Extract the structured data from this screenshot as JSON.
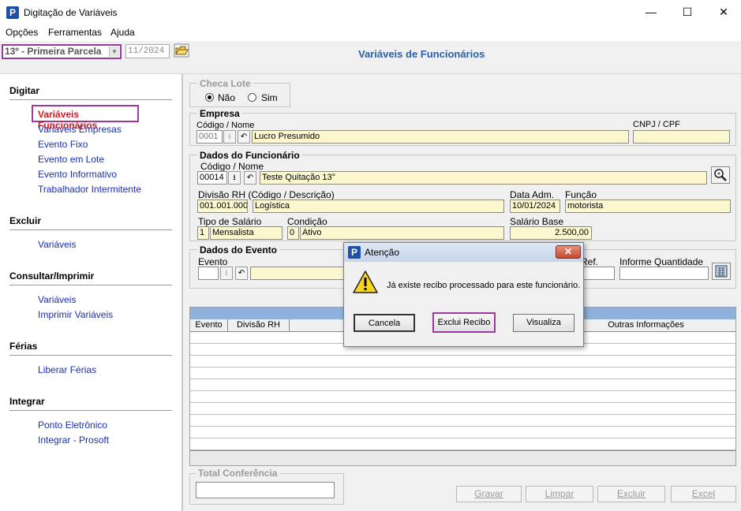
{
  "window": {
    "title": "Digitação de Variáveis",
    "app_icon": "P",
    "controls": {
      "minimize": "—",
      "maximize": "☐",
      "close": "✕"
    }
  },
  "menu": [
    "Opções",
    "Ferramentas",
    "Ajuda"
  ],
  "toolbar": {
    "parcela": "13º - Primeira Parcela",
    "competencia": "11/2024",
    "page_title": "Variáveis de Funcionários"
  },
  "sidebar": {
    "digitar": {
      "header": "Digitar",
      "items": [
        "Variáveis Funcionários",
        "Variáveis Empresas",
        "Evento Fixo",
        "Evento em Lote",
        "Evento Informativo",
        "Trabalhador Intermitente"
      ]
    },
    "excluir": {
      "header": "Excluir",
      "items": [
        "Variáveis"
      ]
    },
    "consultar": {
      "header": "Consultar/Imprimir",
      "items": [
        "Variáveis",
        "Imprimir Variáveis"
      ]
    },
    "ferias": {
      "header": "Férias",
      "items": [
        "Liberar Férias"
      ]
    },
    "integrar": {
      "header": "Integrar",
      "items": [
        "Ponto Eletrônico",
        "Integrar - Prosoft"
      ]
    }
  },
  "checa_lote": {
    "label": "Checa Lote",
    "nao": "Não",
    "sim": "Sim"
  },
  "empresa": {
    "label": "Empresa",
    "codigo_nome_label": "Código / Nome",
    "codigo": "0001",
    "nome": "Lucro Presumido",
    "cnpj_label": "CNPJ / CPF",
    "cnpj": ""
  },
  "funcionario": {
    "label": "Dados do Funcionário",
    "codigo_nome_label": "Código / Nome",
    "codigo": "00014",
    "nome": "Teste Quitação 13°",
    "divisao_label": "Divisão RH (Código / Descrição)",
    "divisao_codigo": "001.001.000",
    "divisao_desc": "Logística",
    "data_adm_label": "Data Adm.",
    "data_adm": "10/01/2024",
    "funcao_label": "Função",
    "funcao": "motorista",
    "tipo_salario_label": "Tipo de Salário",
    "tipo_codigo": "1",
    "tipo_desc": "Mensalista",
    "condicao_label": "Condição",
    "condicao_codigo": "0",
    "condicao_desc": "Ativo",
    "salario_label": "Salário Base",
    "salario": "2.500,00"
  },
  "evento": {
    "label": "Dados do Evento",
    "evento_label": "Evento",
    "ref_label": "Ref.",
    "quantidade_label": "Informe Quantidade"
  },
  "grid": {
    "columns": [
      "Evento",
      "Divisão RH",
      "",
      "",
      "Outras Informações"
    ]
  },
  "total": {
    "label": "Total Conferência",
    "value": ""
  },
  "buttons": {
    "gravar": "Gravar",
    "limpar": "Limpar",
    "excluir": "Excluir",
    "excel": "Excel"
  },
  "dialog": {
    "title": "Atenção",
    "message": "Já existe recibo processado para este funcionário.",
    "cancela": "Cancela",
    "exclui": "Exclui Recibo",
    "visualiza": "Visualiza",
    "close": "✕"
  }
}
